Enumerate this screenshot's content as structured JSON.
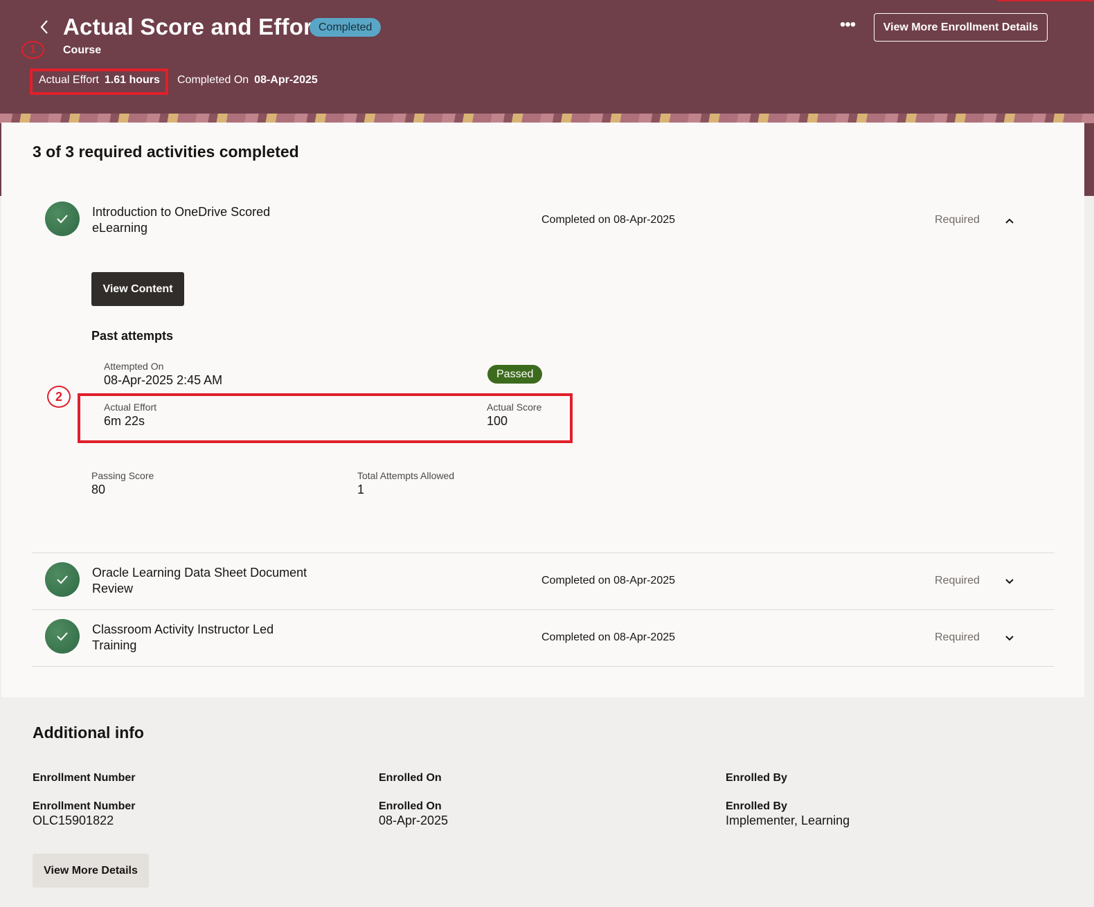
{
  "header": {
    "title": "Actual Score and Effort",
    "status_badge": "Completed",
    "subtitle": "Course",
    "actual_effort_label": "Actual Effort",
    "actual_effort_value": "1.61 hours",
    "completed_on_label": "Completed On",
    "completed_on_value": "08-Apr-2025",
    "more_actions_glyph": "•••",
    "view_more_enrollment_label": "View More Enrollment Details"
  },
  "callouts": {
    "one": "1",
    "two": "2"
  },
  "activities": {
    "summary": "3 of 3 required activities completed",
    "items": [
      {
        "name": "Introduction to OneDrive Scored eLearning",
        "completed": "Completed on 08-Apr-2025",
        "required": "Required",
        "expanded": true
      },
      {
        "name": "Oracle Learning Data Sheet Document Review",
        "completed": "Completed on 08-Apr-2025",
        "required": "Required",
        "expanded": false
      },
      {
        "name": "Classroom Activity Instructor Led Training",
        "completed": "Completed on 08-Apr-2025",
        "required": "Required",
        "expanded": false
      }
    ],
    "view_content_label": "View Content",
    "past_attempts": {
      "title": "Past attempts",
      "attempted_on_label": "Attempted On",
      "attempted_on_value": "08-Apr-2025 2:45 AM",
      "result_badge": "Passed",
      "actual_effort_label": "Actual Effort",
      "actual_effort_value": "6m 22s",
      "actual_score_label": "Actual Score",
      "actual_score_value": "100"
    },
    "passing_score_label": "Passing Score",
    "passing_score_value": "80",
    "total_attempts_label": "Total Attempts Allowed",
    "total_attempts_value": "1"
  },
  "additional_info": {
    "title": "Additional info",
    "headers": [
      "Enrollment Number",
      "Enrolled On",
      "Enrolled By"
    ],
    "fields": [
      {
        "label": "Enrollment Number",
        "value": "OLC15901822"
      },
      {
        "label": "Enrolled On",
        "value": "08-Apr-2025"
      },
      {
        "label": "Enrolled By",
        "value": "Implementer, Learning"
      }
    ],
    "view_more_details_label": "View More Details"
  },
  "icons": {
    "back": "chevron-left-icon",
    "more": "ellipsis-icon",
    "activity_status": "check-circle-icon",
    "collapse": "chevron-up-icon",
    "expand": "chevron-down-icon"
  },
  "colors": {
    "header_bg": "#6f3f4a",
    "completed_badge": "#5aa6c6",
    "passed_badge": "#3d6b1e",
    "highlight_red": "#e0202b",
    "activity_icon": "#2f6a45"
  }
}
